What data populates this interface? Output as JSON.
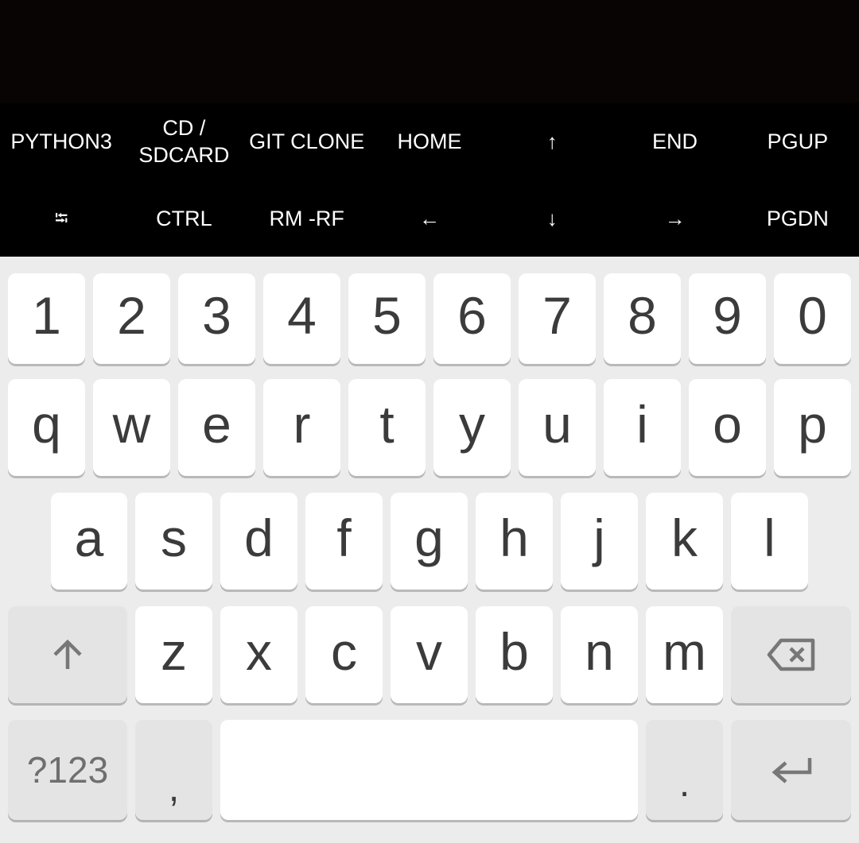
{
  "extra_keys": {
    "row1": [
      {
        "id": "python3",
        "label": "PYTHON3"
      },
      {
        "id": "cd-sdcard",
        "label": "CD /\nSDCARD"
      },
      {
        "id": "git-clone",
        "label": "GIT CLONE"
      },
      {
        "id": "home",
        "label": "HOME"
      },
      {
        "id": "up",
        "label": "↑"
      },
      {
        "id": "end",
        "label": "END"
      },
      {
        "id": "pgup",
        "label": "PGUP"
      }
    ],
    "row2": [
      {
        "id": "tab",
        "label": "⭾"
      },
      {
        "id": "ctrl",
        "label": "CTRL"
      },
      {
        "id": "rm-rf",
        "label": "RM -RF"
      },
      {
        "id": "left",
        "label": "←"
      },
      {
        "id": "down",
        "label": "↓"
      },
      {
        "id": "right",
        "label": "→"
      },
      {
        "id": "pgdn",
        "label": "PGDN"
      }
    ]
  },
  "keyboard": {
    "row_numbers": [
      "1",
      "2",
      "3",
      "4",
      "5",
      "6",
      "7",
      "8",
      "9",
      "0"
    ],
    "row_top": [
      "q",
      "w",
      "e",
      "r",
      "t",
      "y",
      "u",
      "i",
      "o",
      "p"
    ],
    "row_home": [
      "a",
      "s",
      "d",
      "f",
      "g",
      "h",
      "j",
      "k",
      "l"
    ],
    "row_bottom": [
      "z",
      "x",
      "c",
      "v",
      "b",
      "n",
      "m"
    ],
    "symbols_label": "?123",
    "comma_label": ",",
    "period_label": ".",
    "icons": {
      "shift": "shift-arrow-up-icon",
      "backspace": "backspace-icon",
      "enter": "enter-return-icon"
    }
  }
}
